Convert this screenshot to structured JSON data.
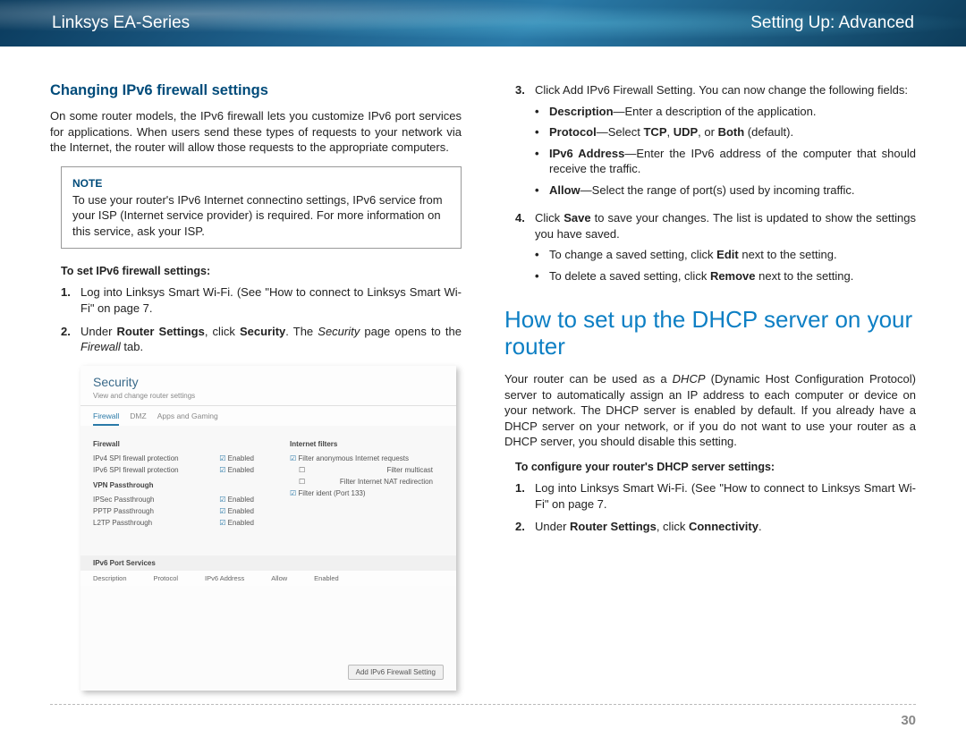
{
  "header": {
    "left": "Linksys EA-Series",
    "right": "Setting Up: Advanced"
  },
  "left": {
    "subheading": "Changing IPv6 firewall settings",
    "intro": "On some router models, the IPv6 firewall lets you customize IPv6 port services for applications. When users send these types of requests to your network via the Internet, the router will allow those requests to the appropriate computers.",
    "note_title": "NOTE",
    "note_body": "To use your router's IPv6 Internet connectino settings, IPv6 service from your ISP (Internet service provider) is required. For more information on this service, ask your ISP.",
    "task_label": "To set IPv6 firewall settings:",
    "step1_a": "Log into Linksys Smart Wi-Fi. (See \"How to connect to Linksys Smart Wi-Fi\" on page 7.",
    "step2_pre": "Under ",
    "step2_b1": "Router Settings",
    "step2_mid": ", click ",
    "step2_b2": "Security",
    "step2_post": ". The ",
    "step2_i": "Security",
    "step2_end": " page opens to the ",
    "step2_i2": "Firewall",
    "step2_end2": " tab."
  },
  "screenshot": {
    "title": "Security",
    "subtitle": "View and change router settings",
    "tabs": [
      "Firewall",
      "DMZ",
      "Apps and Gaming"
    ],
    "fw_label": "Firewall",
    "fw_rows": [
      {
        "l": "IPv4 SPI firewall protection",
        "r": "Enabled"
      },
      {
        "l": "IPv6 SPI firewall protection",
        "r": "Enabled"
      }
    ],
    "vpn_label": "VPN Passthrough",
    "vpn_rows": [
      {
        "l": "IPSec Passthrough",
        "r": "Enabled"
      },
      {
        "l": "PPTP Passthrough",
        "r": "Enabled"
      },
      {
        "l": "L2TP Passthrough",
        "r": "Enabled"
      }
    ],
    "inet_label": "Internet filters",
    "inet_rows": [
      "Filter anonymous Internet requests",
      "Filter multicast",
      "Filter Internet NAT redirection",
      "Filter ident (Port 133)"
    ],
    "ipv6ports_label": "IPv6 Port Services",
    "cols": [
      "Description",
      "Protocol",
      "IPv6 Address",
      "Allow",
      "Enabled"
    ],
    "button": "Add IPv6 Firewall Setting"
  },
  "right": {
    "step3_pre": "Click Add IPv6 Firewall Setting. You can now change the following fields:",
    "b_desc_l": "Description",
    "b_desc_r": "—Enter a description of the application.",
    "b_proto_l": "Protocol",
    "b_proto_m": "—Select ",
    "b_proto_tcp": "TCP",
    "b_proto_c": ", ",
    "b_proto_udp": "UDP",
    "b_proto_or": ", or ",
    "b_proto_both": "Both",
    "b_proto_end": " (default).",
    "b_addr_l": "IPv6 Address",
    "b_addr_r": "—Enter the IPv6 address of the computer that should receive the traffic.",
    "b_allow_l": "Allow",
    "b_allow_r": "—Select the range of port(s) used by incoming traffic.",
    "step4_a": "Click ",
    "step4_b": "Save",
    "step4_c": " to save your changes. The list is updated to show the settings you have saved.",
    "sub_edit_a": "To change a saved setting, click ",
    "sub_edit_b": "Edit",
    "sub_edit_c": " next to the setting.",
    "sub_rem_a": "To delete a saved setting, click ",
    "sub_rem_b": "Remove",
    "sub_rem_c": " next to the setting.",
    "heading2": "How to set up the DHCP server on your router",
    "para2_a": "Your router can be used as a ",
    "para2_i": "DHCP",
    "para2_b": " (Dynamic Host Configuration Protocol) server to automatically assign an IP address to each computer or device on your network. The DHCP server is enabled by default. If you already have a DHCP server on your network, or if you do not want to use your router as a DHCP server, you should disable this setting.",
    "task2_label": "To configure your router's DHCP server settings:",
    "t2_step1": "Log into Linksys Smart Wi-Fi. (See \"How to connect to Linksys Smart Wi-Fi\" on page 7.",
    "t2_step2_a": "Under ",
    "t2_step2_b": "Router Settings",
    "t2_step2_c": ", click ",
    "t2_step2_d": "Connectivity",
    "t2_step2_e": "."
  },
  "page": "30"
}
